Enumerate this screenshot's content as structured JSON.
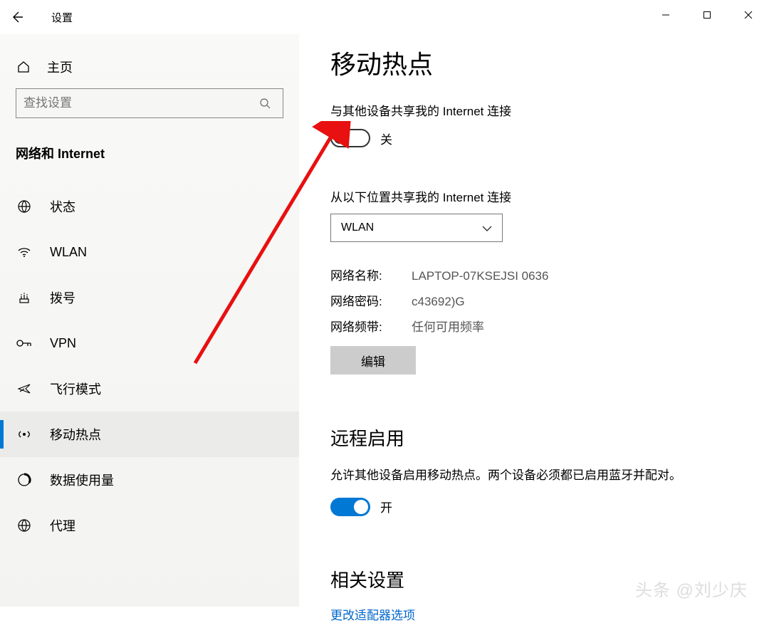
{
  "titlebar": {
    "app_name": "设置"
  },
  "sidebar": {
    "home": "主页",
    "search_placeholder": "查找设置",
    "category": "网络和 Internet",
    "items": [
      {
        "icon": "status",
        "label": "状态"
      },
      {
        "icon": "wifi",
        "label": "WLAN"
      },
      {
        "icon": "dialup",
        "label": "拨号"
      },
      {
        "icon": "vpn",
        "label": "VPN"
      },
      {
        "icon": "plane",
        "label": "飞行模式"
      },
      {
        "icon": "hotspot",
        "label": "移动热点"
      },
      {
        "icon": "data",
        "label": "数据使用量"
      },
      {
        "icon": "proxy",
        "label": "代理"
      }
    ]
  },
  "main": {
    "title": "移动热点",
    "share_label": "与其他设备共享我的 Internet 连接",
    "share_state": "关",
    "share_from_label": "从以下位置共享我的 Internet 连接",
    "share_from_value": "WLAN",
    "network": {
      "name_key": "网络名称:",
      "name_val": "LAPTOP-07KSEJSI 0636",
      "pass_key": "网络密码:",
      "pass_val": "c43692)G",
      "band_key": "网络频带:",
      "band_val": "任何可用频率"
    },
    "edit_btn": "编辑",
    "remote_heading": "远程启用",
    "remote_desc": "允许其他设备启用移动热点。两个设备必须都已启用蓝牙并配对。",
    "remote_state": "开",
    "related_heading": "相关设置",
    "related_link": "更改适配器选项"
  },
  "watermark": "头条 @刘少庆"
}
